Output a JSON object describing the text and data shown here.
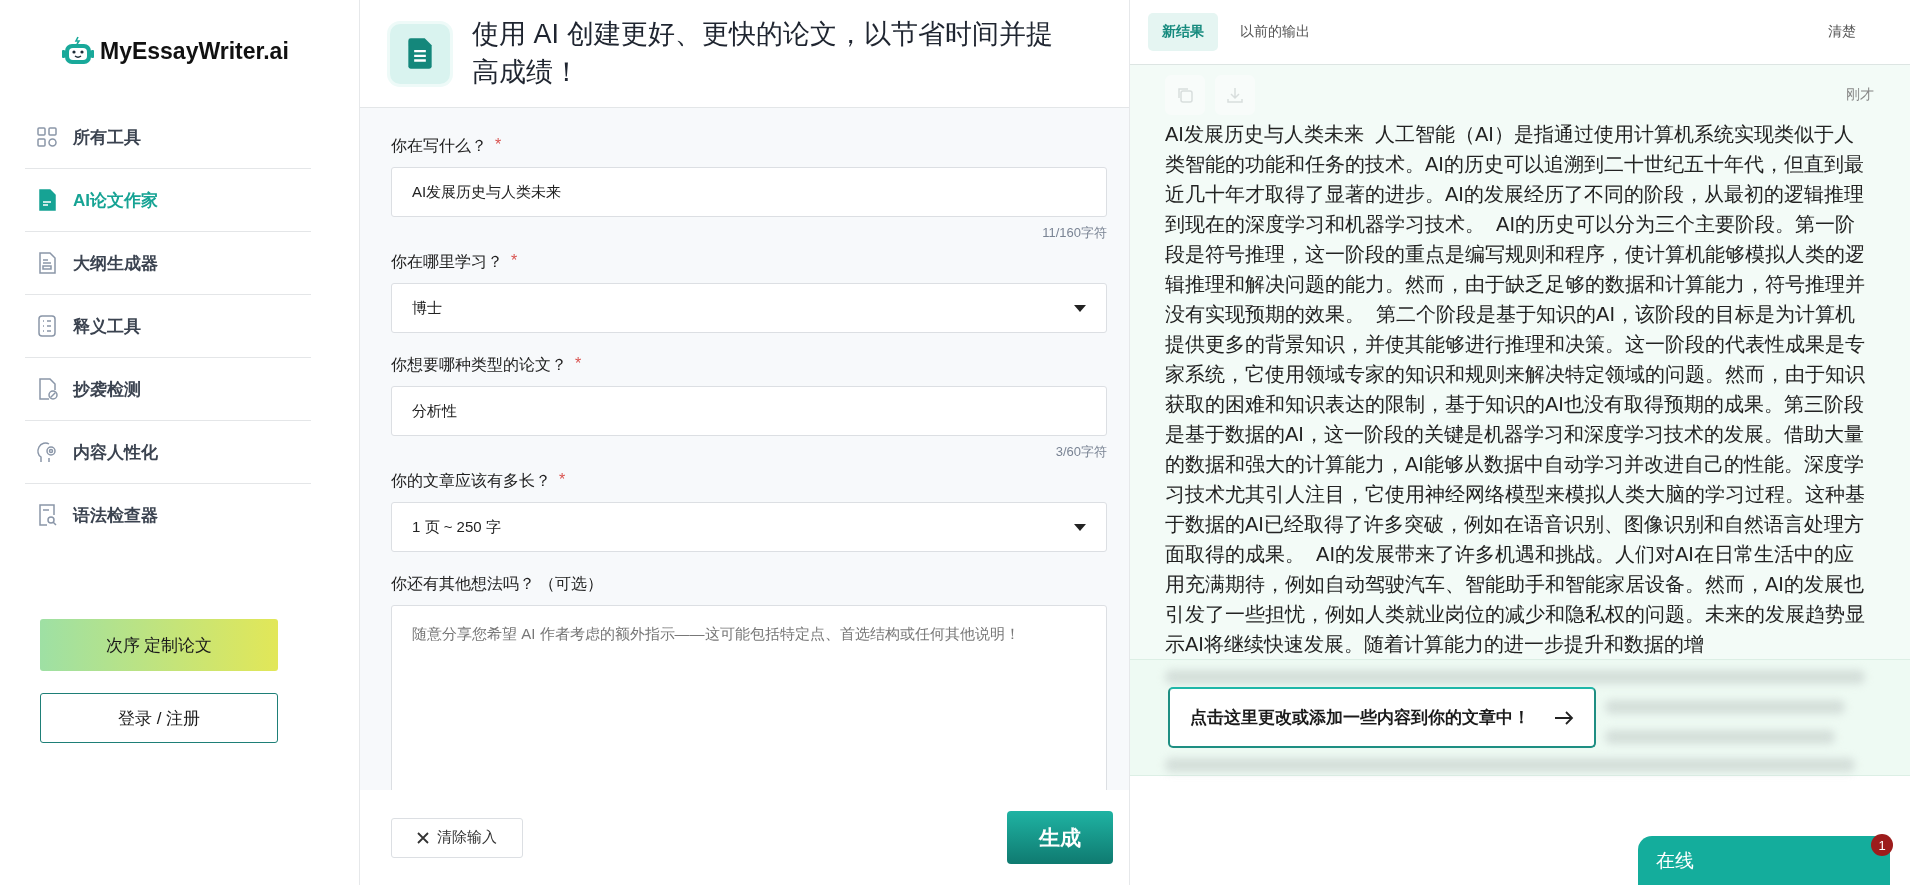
{
  "logo": {
    "text": "MyEssayWriter.ai"
  },
  "sidebar": {
    "items": [
      {
        "label": "所有工具",
        "selected": false
      },
      {
        "label": "AI论文作家",
        "selected": true
      },
      {
        "label": "大纲生成器",
        "selected": false
      },
      {
        "label": "释义工具",
        "selected": false
      },
      {
        "label": "抄袭检测",
        "selected": false
      },
      {
        "label": "内容人性化",
        "selected": false
      },
      {
        "label": "语法检查器",
        "selected": false
      }
    ],
    "order_button": "次序 定制论文",
    "login_button": "登录 / 注册"
  },
  "header": {
    "title": "使用 AI 创建更好、更快的论文，以节省时间并提高成绩！"
  },
  "form": {
    "fields": [
      {
        "kind": "text",
        "label": "你在写什么？",
        "required_mark": "*",
        "value": "AI发展历史与人类未来",
        "counter": "11/160字符"
      },
      {
        "kind": "select",
        "label": "你在哪里学习？",
        "required_mark": "*",
        "value": "博士"
      },
      {
        "kind": "text",
        "label": "你想要哪种类型的论文？",
        "required_mark": "*",
        "value": "分析性",
        "counter": "3/60字符"
      },
      {
        "kind": "select",
        "label": "你的文章应该有多长？",
        "required_mark": "*",
        "value": "1 页 ~ 250 字"
      },
      {
        "kind": "textarea",
        "label": "你还有其他想法吗？ （可选）",
        "placeholder": "随意分享您希望 AI 作者考虑的额外指示——这可能包括特定点、首选结构或任何其他说明！"
      }
    ]
  },
  "footer": {
    "clear_button": "清除输入",
    "generate_button": "生成"
  },
  "results": {
    "tabs": [
      {
        "label": "新结果",
        "selected": true
      },
      {
        "label": "以前的输出",
        "selected": false
      }
    ],
    "clear": "清楚",
    "timestamp": "刚才",
    "text": "AI发展历史与人类未来  人工智能（AI）是指通过使用计算机系统实现类似于人类智能的功能和任务的技术。AI的历史可以追溯到二十世纪五十年代，但直到最近几十年才取得了显著的进步。AI的发展经历了不同的阶段，从最初的逻辑推理到现在的深度学习和机器学习技术。  AI的历史可以分为三个主要阶段。第一阶段是符号推理，这一阶段的重点是编写规则和程序，使计算机能够模拟人类的逻辑推理和解决问题的能力。然而，由于缺乏足够的数据和计算能力，符号推理并没有实现预期的效果。  第二个阶段是基于知识的AI，该阶段的目标是为计算机提供更多的背景知识，并使其能够进行推理和决策。这一阶段的代表性成果是专家系统，它使用领域专家的知识和规则来解决特定领域的问题。然而，由于知识获取的困难和知识表达的限制，基于知识的AI也没有取得预期的成果。第三阶段是基于数据的AI，这一阶段的关键是机器学习和深度学习技术的发展。借助大量的数据和强大的计算能力，AI能够从数据中自动学习并改进自己的性能。深度学习技术尤其引人注目，它使用神经网络模型来模拟人类大脑的学习过程。这种基于数据的AI已经取得了许多突破，例如在语音识别、图像识别和自然语言处理方面取得的成果。  AI的发展带来了许多机遇和挑战。人们对AI在日常生活中的应用充满期待，例如自动驾驶汽车、智能助手和智能家居设备。然而，AI的发展也引发了一些担忧，例如人类就业岗位的减少和隐私权的问题。未来的发展趋势显示AI将继续快速发展。随着计算能力的进一步提升和数据的增",
    "cta": "点击这里更改或添加一些内容到你的文章中！"
  },
  "chat": {
    "label": "在线",
    "badge": "1"
  }
}
